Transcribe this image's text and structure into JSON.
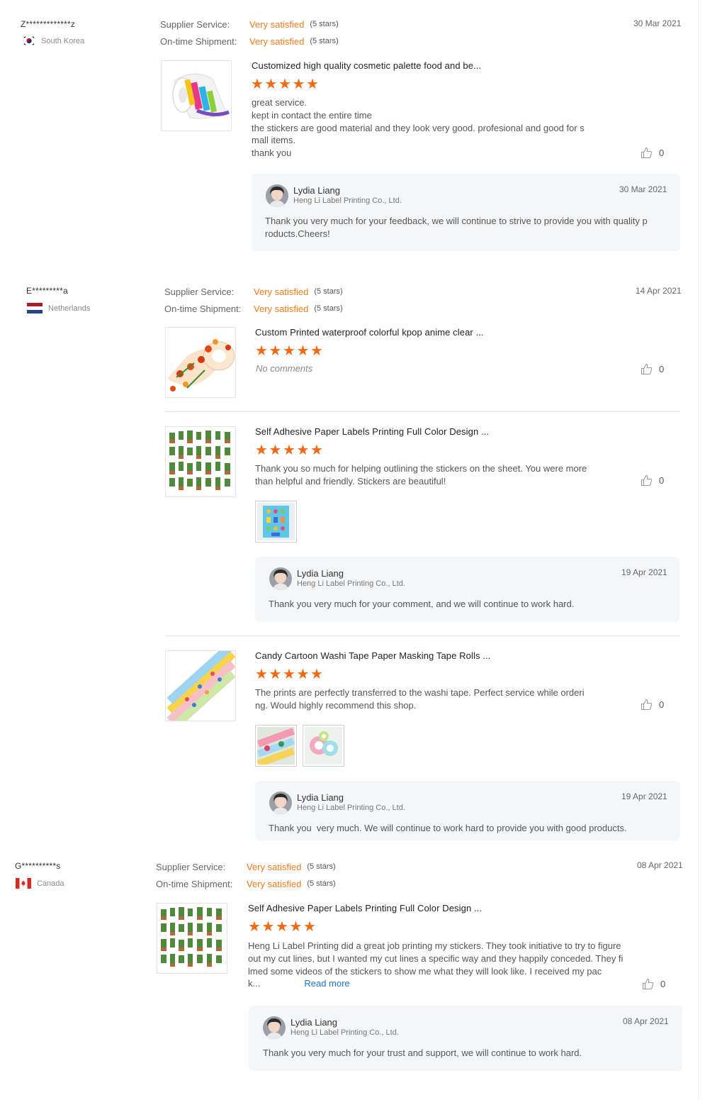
{
  "reviews": [
    {
      "buyer": "Z*************z",
      "country": "South Korea",
      "supplier_service_label": "Supplier Service:",
      "supplier_service_value": "Very satisfied",
      "supplier_service_stars": "(5 stars)",
      "shipment_label": "On-time Shipment:",
      "shipment_value": "Very satisfied",
      "shipment_stars": "(5 stars)",
      "date": "30 Mar 2021",
      "products": [
        {
          "title": "Customized high quality cosmetic palette food and be...",
          "rating": 5,
          "comment_lines": [
            "great service.",
            "kept in contact the entire time",
            "the stickers are good material and they look very good. profesional and good for s",
            "mall items.",
            "thank you"
          ],
          "likes": "0",
          "reply": {
            "name": "Lydia Liang",
            "company": "Heng Li Label Printing Co., Ltd.",
            "date": "30 Mar 2021",
            "text_lines": [
              "Thank you very much for your feedback, we will continue to strive to provide you with quality p",
              "roducts.Cheers!"
            ]
          }
        }
      ]
    },
    {
      "buyer": "E*********a",
      "country": "Netherlands",
      "supplier_service_label": "Supplier Service:",
      "supplier_service_value": "Very satisfied",
      "supplier_service_stars": "(5 stars)",
      "shipment_label": "On-time Shipment:",
      "shipment_value": "Very satisfied",
      "shipment_stars": "(5 stars)",
      "date": "14 Apr 2021",
      "products": [
        {
          "title": "Custom Printed waterproof colorful kpop anime clear ...",
          "rating": 5,
          "no_comment": "No comments",
          "likes": "0"
        },
        {
          "title": "Self Adhesive Paper Labels Printing Full Color Design ...",
          "rating": 5,
          "comment_lines": [
            "Thank you so much for helping outlining the stickers on the sheet. You were more",
            "than helpful and friendly. Stickers are beautiful!"
          ],
          "likes": "0",
          "reply": {
            "name": "Lydia Liang",
            "company": "Heng Li Label Printing Co., Ltd.",
            "date": "19 Apr 2021",
            "text_lines": [
              "Thank you very much for your comment, and we will continue to work hard."
            ]
          }
        },
        {
          "title": "Candy Cartoon Washi Tape Paper Masking Tape Rolls ...",
          "rating": 5,
          "comment_lines": [
            "The prints are perfectly transferred to the washi tape. Perfect service while orderi",
            "ng. Would highly recommend this shop."
          ],
          "likes": "0",
          "reply": {
            "name": "Lydia Liang",
            "company": "Heng Li Label Printing Co., Ltd.",
            "date": "19 Apr 2021",
            "text_lines": [
              "Thank you  very much. We will continue to work hard to provide you with good products."
            ]
          }
        }
      ]
    },
    {
      "buyer": "G**********s",
      "country": "Canada",
      "supplier_service_label": "Supplier Service:",
      "supplier_service_value": "Very satisfied",
      "supplier_service_stars": "(5 stars)",
      "shipment_label": "On-time Shipment:",
      "shipment_value": "Very satisfied",
      "shipment_stars": "(5 stars)",
      "date": "08 Apr 2021",
      "products": [
        {
          "title": "Self Adhesive Paper Labels Printing Full Color Design ...",
          "rating": 5,
          "comment_lines": [
            "Heng Li Label Printing did a great job printing my stickers. They took initiative to try to figure",
            "out my cut lines, but I wanted my cut lines a specific way and they happily conceded. They fi",
            "lmed some videos of the stickers to show me what they will look like. I received my pac",
            "k..."
          ],
          "read_more": "Read more",
          "likes": "0",
          "reply": {
            "name": "Lydia Liang",
            "company": "Heng Li Label Printing Co., Ltd.",
            "date": "08 Apr 2021",
            "text_lines": [
              "Thank you very much for your trust and support, we will continue to work hard."
            ]
          }
        }
      ]
    }
  ],
  "colors": {
    "accent": "#f27a1a",
    "star": "#f46a14",
    "link": "#1a73c8",
    "reply_bg": "#f5f6f8"
  },
  "icons": {
    "like": "thumbs-up-icon",
    "star": "star-icon"
  }
}
